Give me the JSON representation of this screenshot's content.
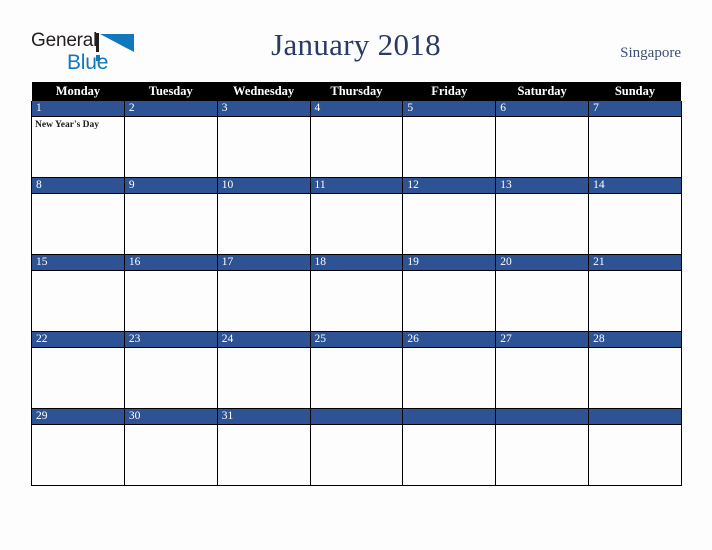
{
  "brand": {
    "name_top": "General",
    "name_bottom": "Blue",
    "triangle_color": "#1278be",
    "text_color": "#231f20"
  },
  "header": {
    "title": "January 2018",
    "country": "Singapore",
    "title_color": "#2a3b63"
  },
  "calendar": {
    "weekday_headers": [
      "Monday",
      "Tuesday",
      "Wednesday",
      "Thursday",
      "Friday",
      "Saturday",
      "Sunday"
    ],
    "header_bg": "#000000",
    "header_text": "#ffffff",
    "daynum_bg": "#2e5395",
    "daynum_text": "#ffffff",
    "cell_bg": "#fdfdfd",
    "weeks": [
      [
        {
          "day": "1",
          "events": [
            "New Year's Day"
          ]
        },
        {
          "day": "2",
          "events": []
        },
        {
          "day": "3",
          "events": []
        },
        {
          "day": "4",
          "events": []
        },
        {
          "day": "5",
          "events": []
        },
        {
          "day": "6",
          "events": []
        },
        {
          "day": "7",
          "events": []
        }
      ],
      [
        {
          "day": "8",
          "events": []
        },
        {
          "day": "9",
          "events": []
        },
        {
          "day": "10",
          "events": []
        },
        {
          "day": "11",
          "events": []
        },
        {
          "day": "12",
          "events": []
        },
        {
          "day": "13",
          "events": []
        },
        {
          "day": "14",
          "events": []
        }
      ],
      [
        {
          "day": "15",
          "events": []
        },
        {
          "day": "16",
          "events": []
        },
        {
          "day": "17",
          "events": []
        },
        {
          "day": "18",
          "events": []
        },
        {
          "day": "19",
          "events": []
        },
        {
          "day": "20",
          "events": []
        },
        {
          "day": "21",
          "events": []
        }
      ],
      [
        {
          "day": "22",
          "events": []
        },
        {
          "day": "23",
          "events": []
        },
        {
          "day": "24",
          "events": []
        },
        {
          "day": "25",
          "events": []
        },
        {
          "day": "26",
          "events": []
        },
        {
          "day": "27",
          "events": []
        },
        {
          "day": "28",
          "events": []
        }
      ],
      [
        {
          "day": "29",
          "events": []
        },
        {
          "day": "30",
          "events": []
        },
        {
          "day": "31",
          "events": []
        },
        {
          "day": "",
          "events": []
        },
        {
          "day": "",
          "events": []
        },
        {
          "day": "",
          "events": []
        },
        {
          "day": "",
          "events": []
        }
      ]
    ]
  }
}
